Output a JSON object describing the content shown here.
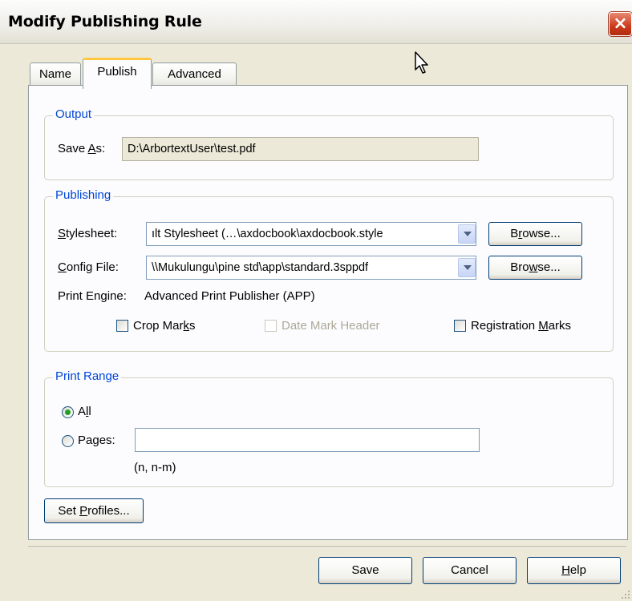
{
  "window": {
    "title": "Modify Publishing Rule",
    "close_label": "×"
  },
  "tabs": [
    {
      "label": "Name",
      "active": false
    },
    {
      "label": "Publish",
      "active": true
    },
    {
      "label": "Advanced",
      "active": false
    }
  ],
  "output": {
    "group_title": "Output",
    "save_as_label_pre": "Save ",
    "save_as_label_mnemonic": "A",
    "save_as_label_post": "s:",
    "save_as_value": "D:\\ArbortextUser\\test.pdf"
  },
  "publishing": {
    "group_title": "Publishing",
    "stylesheet_label_mnemonic": "S",
    "stylesheet_label_rest": "tylesheet:",
    "stylesheet_value": "ılt Stylesheet   (…\\axdocbook\\axdocbook.style",
    "config_label_mnemonic": "C",
    "config_label_rest": "onfig File:",
    "config_value": "\\\\Mukulungu\\pine std\\app\\standard.3sppdf",
    "browse1_pre": "B",
    "browse1_mnemonic": "r",
    "browse1_post": "owse...",
    "browse2_pre": "Bro",
    "browse2_mnemonic": "w",
    "browse2_post": "se...",
    "print_engine_label": "Print Engine:",
    "print_engine_value": "Advanced Print Publisher (APP)",
    "crop_marks_pre": "Crop Mar",
    "crop_marks_mnemonic": "k",
    "crop_marks_post": "s",
    "crop_marks_checked": false,
    "date_mark_label": "Date Mark Header",
    "date_mark_enabled": false,
    "registration_pre": "Registration ",
    "registration_mnemonic": "M",
    "registration_post": "arks",
    "registration_checked": false
  },
  "print_range": {
    "group_title": "Print Range",
    "all_pre": "A",
    "all_mnemonic": "l",
    "all_post": "l",
    "all_selected": true,
    "pages_pre": "Pa",
    "pages_mnemonic": "g",
    "pages_post": "es:",
    "pages_value": "",
    "pages_hint": "(n, n-m)"
  },
  "set_profiles": {
    "pre": "Set ",
    "mnemonic": "P",
    "post": "rofiles..."
  },
  "footer": {
    "save_label": "Save",
    "cancel_label": "Cancel",
    "help_mnemonic": "H",
    "help_post": "elp"
  }
}
